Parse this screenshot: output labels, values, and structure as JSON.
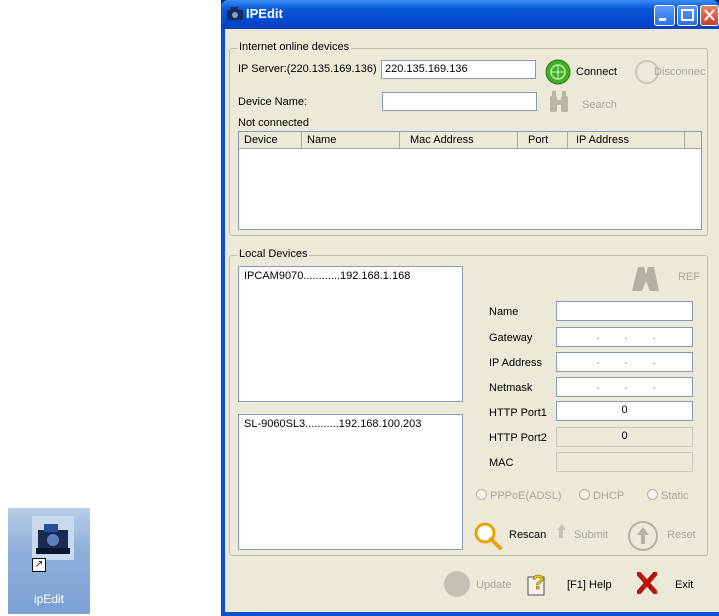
{
  "desktop": {
    "shortcut_label": "ipEdit"
  },
  "window": {
    "title": "IPEdit"
  },
  "internet": {
    "legend": "Internet online devices",
    "ip_server_label": "IP Server:(220.135.169.136)",
    "ip_server_value": "220.135.169.136",
    "connect_label": "Connect",
    "disconnect_label": "Disconnec",
    "device_name_label": "Device Name:",
    "device_name_value": "",
    "search_label": "Search",
    "status": "Not connected",
    "columns": [
      "Device",
      "Name",
      "Mac Address",
      "Port",
      "IP Address"
    ]
  },
  "local": {
    "legend": "Local Devices",
    "list1": [
      "IPCAM9070............192.168.1.168"
    ],
    "list2": [
      "SL-9060SL3...........192.168.100.203"
    ],
    "ref_label": "REF",
    "fields": {
      "name_label": "Name",
      "name_value": "",
      "gateway_label": "Gateway",
      "gateway_value": ". . .",
      "ip_label": "IP Address",
      "ip_value": ". . .",
      "netmask_label": "Netmask",
      "netmask_value": ". . .",
      "http1_label": "HTTP Port1",
      "http1_value": "0",
      "http2_label": "HTTP Port2",
      "http2_value": "0",
      "mac_label": "MAC",
      "mac_value": ""
    },
    "radios": [
      "PPPoE(ADSL)",
      "DHCP",
      "Static"
    ],
    "rescan_label": "Rescan",
    "submit_label": "Submit",
    "reset_label": "Reset"
  },
  "bottom": {
    "update_label": "Update",
    "help_label": "[F1] Help",
    "exit_label": "Exit"
  }
}
